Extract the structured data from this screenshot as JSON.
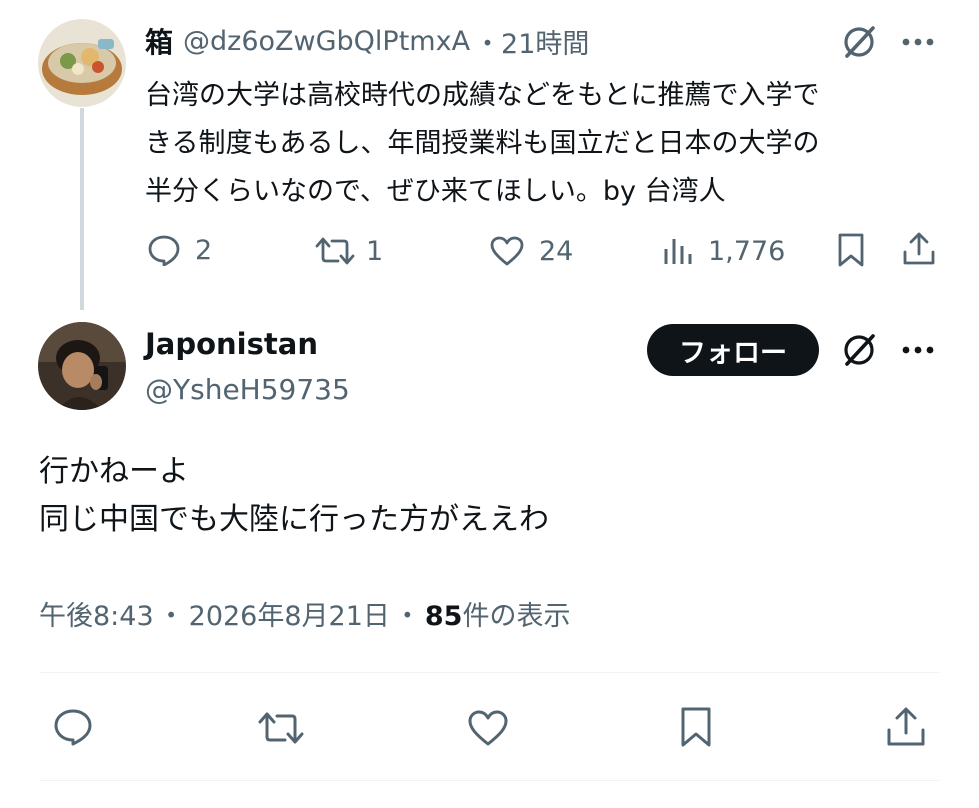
{
  "reply_tweet": {
    "display_name": "箱",
    "handle": "@dz6oZwGbQlPtmxA",
    "separator": "・",
    "time": "21時間",
    "text_lines": [
      "台湾の大学は高校時代の成績などをもとに推薦で入学で",
      "きる制度もあるし、年間授業料も国立だと日本の大学の",
      "半分くらいなので、ぜひ来てほしい。by 台湾人"
    ],
    "reply_count": "2",
    "retweet_count": "1",
    "like_count": "24",
    "view_count": "1,776"
  },
  "main_tweet": {
    "display_name": "Japonistan",
    "handle": "@YsheH59735",
    "follow_label": "フォロー",
    "text_lines": [
      "行かねーよ",
      "同じ中国でも大陸に行った方がええわ"
    ],
    "meta_time": "午後8:43",
    "meta_separator_1": "・",
    "meta_date": "2026年8月21日",
    "meta_separator_2": "・",
    "meta_views_number": "85",
    "meta_views_label": " 件の表示"
  },
  "icons": {
    "reply": "reply-icon",
    "retweet": "retweet-icon",
    "like": "heart-icon",
    "views": "views-chart-icon",
    "bookmark": "bookmark-icon",
    "share": "share-icon",
    "grok": "grok-icon",
    "more": "more-icon"
  },
  "colors": {
    "text": "#0f1419",
    "secondary": "#536471",
    "thread_line": "#cfd9de",
    "follow_bg": "#0f1419",
    "divider": "#eff3f4"
  }
}
